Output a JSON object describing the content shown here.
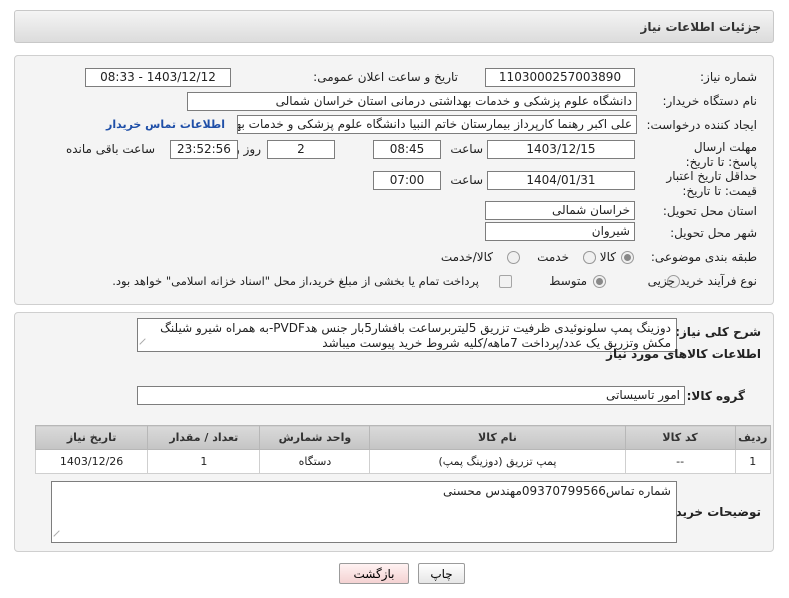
{
  "header": {
    "title": "جزئیات اطلاعات نیاز"
  },
  "form": {
    "need_number_label": "شماره نیاز:",
    "need_number": "1103000257003890",
    "announce_label": "تاریخ و ساعت اعلان عمومی:",
    "announce_value": "1403/12/12 - 08:33",
    "buyer_label": "نام دستگاه خریدار:",
    "buyer_value": "دانشگاه علوم پزشکی و خدمات بهداشتی درمانی استان خراسان شمالی",
    "requester_label": "ایجاد کننده درخواست:",
    "requester_value": "علی اکبر رهنما کارپرداز بیمارستان خاتم النبیا دانشگاه علوم پزشکی و خدمات بهداشتی",
    "contact_link": "اطلاعات تماس خریدار",
    "deadline_label": "مهلت ارسال پاسخ: تا تاریخ:",
    "deadline_date": "1403/12/15",
    "time_label": "ساعت",
    "deadline_time": "08:45",
    "days_value": "2",
    "days_label": "روز و",
    "remaining_time": "23:52:56",
    "remaining_label": "ساعت باقی مانده",
    "min_validity_label": "حداقل تاریخ اعتبار قیمت: تا تاریخ:",
    "validity_date": "1404/01/31",
    "validity_time": "07:00",
    "province_label": "استان محل تحویل:",
    "province_value": "خراسان شمالی",
    "city_label": "شهر محل تحویل:",
    "city_value": "شیروان",
    "category_label": "طبقه بندی موضوعی:",
    "category_options": [
      "کالا",
      "خدمت",
      "کالا/خدمت"
    ],
    "process_label": "نوع فرآیند خرید :",
    "process_options": [
      "جزیی",
      "متوسط"
    ],
    "payment_note": "پرداخت تمام یا بخشی از مبلغ خرید،از محل \"اسناد خزانه اسلامی\" خواهد بود."
  },
  "details": {
    "summary_label": "شرح کلی نیاز:",
    "summary_text": "دوزینگ پمپ سلونوئیدی ظرفیت تزریق 5لیتربرساعت بافشار5بار جنس هدPVDF-به همراه شیرو شیلنگ مکش وتزریق یک عدد/پرداخت 7ماهه/کلیه شروط خرید پیوست میباشد",
    "goods_info_title": "اطلاعات کالاهای مورد نیاز",
    "goods_group_label": "گروه کالا:",
    "goods_group_value": "امور تاسیساتی",
    "table": {
      "headers": [
        "ردیف",
        "کد کالا",
        "نام کالا",
        "واحد شمارش",
        "تعداد / مقدار",
        "تاریخ نیاز"
      ],
      "rows": [
        [
          "1",
          "--",
          "پمپ تزریق (دوزینگ پمپ)",
          "دستگاه",
          "1",
          "1403/12/26"
        ]
      ]
    },
    "buyer_notes_label": "توضیحات خریدار:",
    "buyer_notes_text": "شماره تماس09370799566مهندس محسنی"
  },
  "actions": {
    "print": "چاپ",
    "back": "بازگشت"
  }
}
